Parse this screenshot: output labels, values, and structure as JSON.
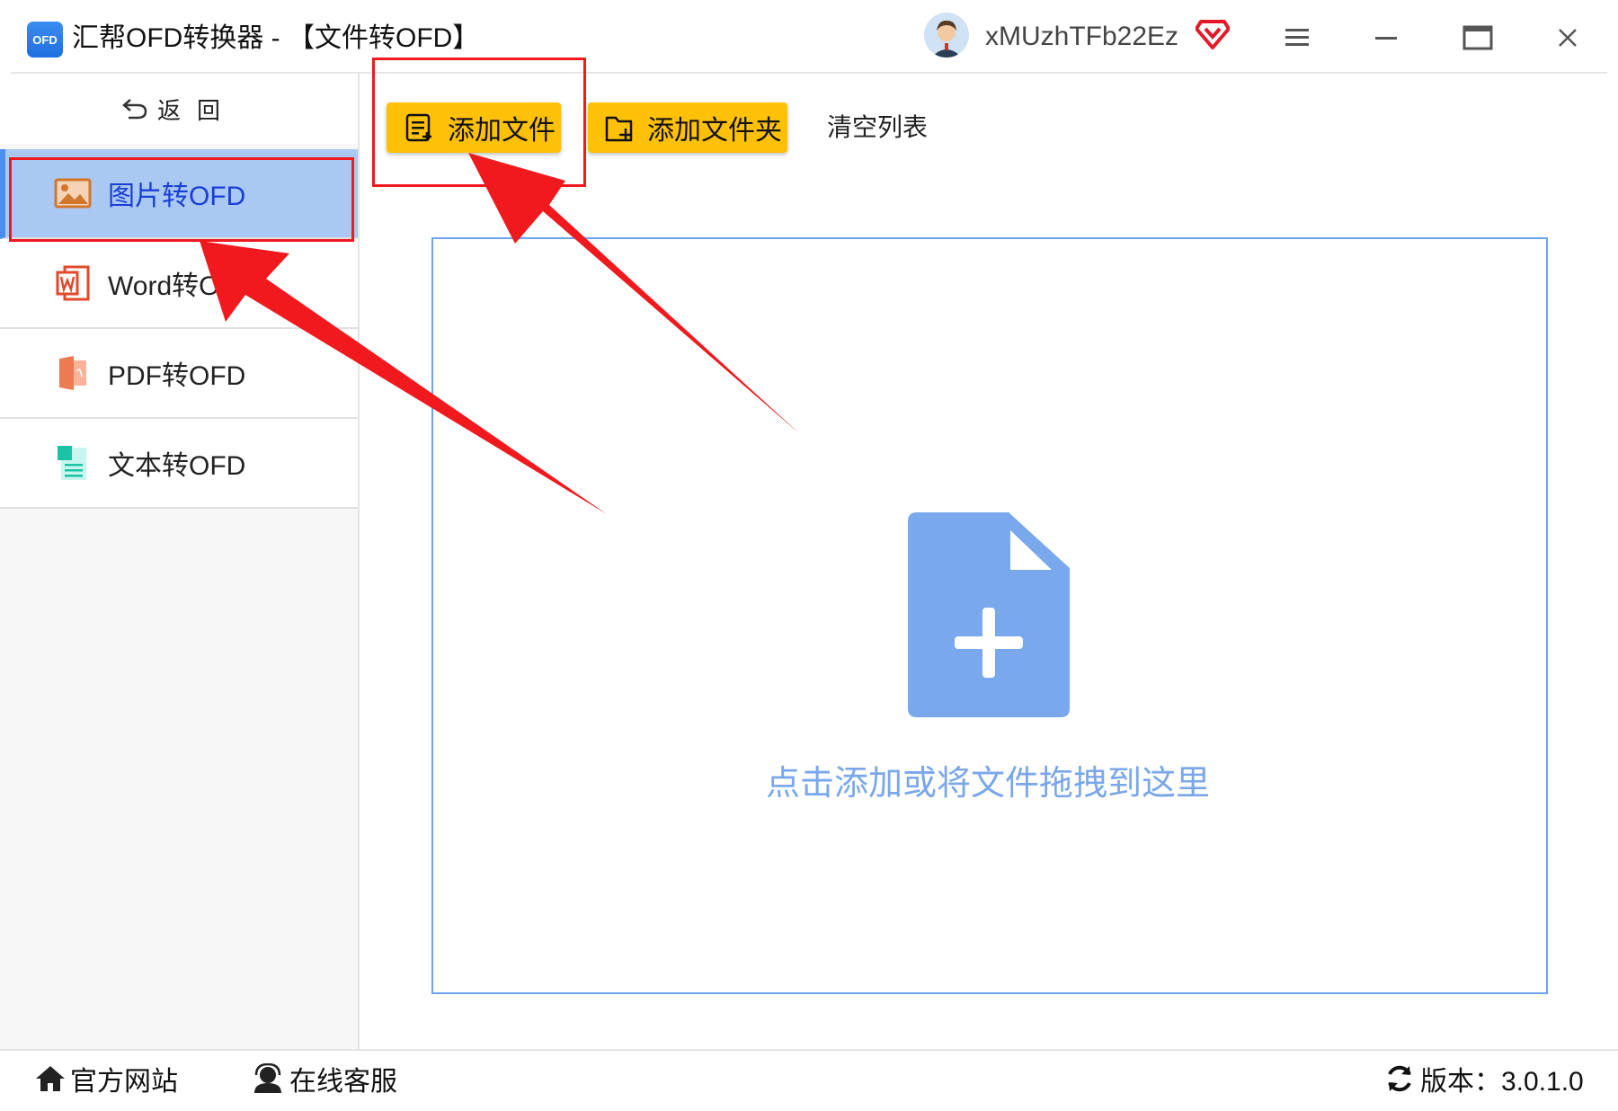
{
  "window": {
    "title": "汇帮OFD转换器 - 【文件转OFD】",
    "logo_text": "OFD",
    "username": "xMUzhTFb22Ez",
    "controls": [
      "menu-icon",
      "minimize-icon",
      "maximize-icon",
      "close-icon"
    ]
  },
  "sidebar": {
    "back_label": "返回",
    "items": [
      {
        "label": "图片转OFD",
        "icon": "image-icon",
        "active": true
      },
      {
        "label": "Word转OFD",
        "icon": "word-icon",
        "active": false
      },
      {
        "label": "PDF转OFD",
        "icon": "pdf-icon",
        "active": false
      },
      {
        "label": "文本转OFD",
        "icon": "text-file-icon",
        "active": false
      }
    ]
  },
  "toolbar": {
    "add_file": "添加文件",
    "add_folder": "添加文件夹",
    "clear_list": "清空列表"
  },
  "dropzone": {
    "hint": "点击添加或将文件拖拽到这里",
    "icon": "file-add-icon"
  },
  "statusbar": {
    "website": "官方网站",
    "support": "在线客服",
    "version": "版本：3.0.1.0"
  },
  "colors": {
    "accent_yellow": "#ffc107",
    "active_nav": "#a9c8f2",
    "dropzone_blue": "#7aa7ea",
    "annotation_red": "#f0191e"
  }
}
